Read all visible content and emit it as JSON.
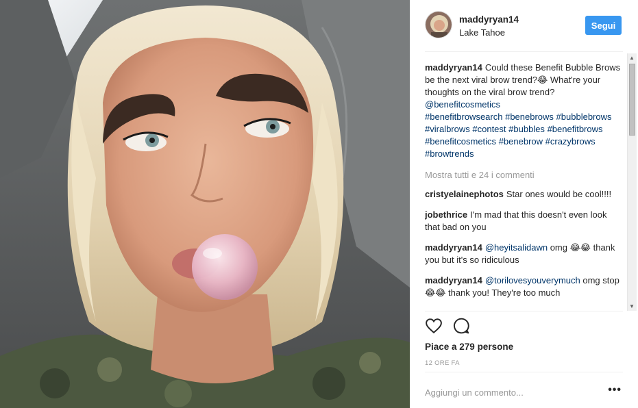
{
  "photo": {
    "alt": ""
  },
  "header": {
    "username": "maddyryan14",
    "location": "Lake Tahoe",
    "follow_label": "Segui"
  },
  "caption": {
    "username": "maddyryan14",
    "text": "Could these Benefit Bubble Brows be the next viral brow trend?😂 What're your thoughts on the viral brow trend?",
    "mention": "@benefitcosmetics",
    "tags": [
      "#benefitbrowsearch",
      "#benebrows",
      "#bubblebrows",
      "#viralbrows",
      "#contest",
      "#bubbles",
      "#benefitbrows",
      "#benefitcosmetics",
      "#benebrow",
      "#crazybrows",
      "#browtrends"
    ]
  },
  "view_all": "Mostra tutti e 24 i commenti",
  "comments": [
    {
      "username": "cristyelainephotos",
      "mention": "",
      "text": "Star ones would be cool!!!!"
    },
    {
      "username": "jobethrice",
      "mention": "",
      "text": "I'm mad that this doesn't even look that bad on you"
    },
    {
      "username": "maddyryan14",
      "mention": "@heyitsalidawn",
      "text": "omg 😂😂 thank you but it's so ridiculous"
    },
    {
      "username": "maddyryan14",
      "mention": "@torilovesyouverymuch",
      "text": "omg stop 😂😂 thank you! They're too much"
    }
  ],
  "icons": {
    "like": "heart-icon",
    "comment": "comment-bubble-icon",
    "more": "more-options-icon"
  },
  "likes": "Piace a 279 persone",
  "timestamp": "12 ORE FA",
  "add_comment_placeholder": "Aggiungi un commento...",
  "more_options": "•••",
  "colors": {
    "follow_button": "#3897f0",
    "link": "#003569",
    "muted": "#999999"
  }
}
